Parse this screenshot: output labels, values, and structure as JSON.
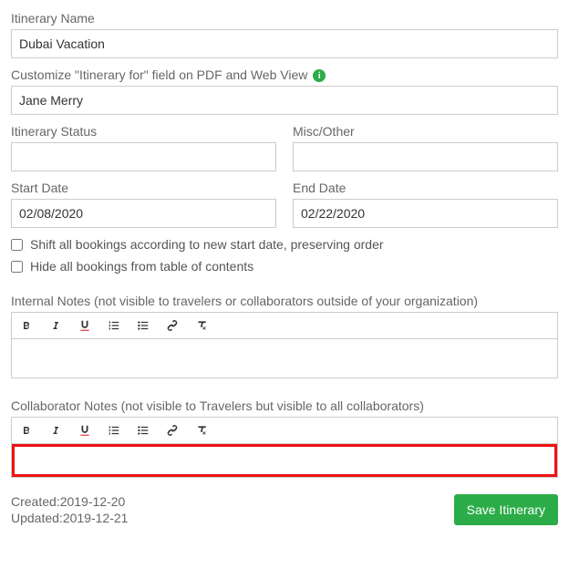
{
  "itinerary_name_label": "Itinerary Name",
  "itinerary_name_value": "Dubai Vacation",
  "customize_label": "Customize \"Itinerary for\" field on PDF and Web View",
  "customize_value": "Jane Merry",
  "status_label": "Itinerary Status",
  "status_value": "",
  "misc_label": "Misc/Other",
  "misc_value": "",
  "start_date_label": "Start Date",
  "start_date_value": "02/08/2020",
  "end_date_label": "End Date",
  "end_date_value": "02/22/2020",
  "shift_label": "Shift all bookings according to new start date, preserving order",
  "hide_label": "Hide all bookings from table of contents",
  "internal_notes_label": "Internal Notes (not visible to travelers or collaborators outside of your organization)",
  "collab_notes_label": "Collaborator Notes (not visible to Travelers but visible to all collaborators)",
  "created_label": "Created:",
  "created_value": "2019-12-20",
  "updated_label": "Updated:",
  "updated_value": "2019-12-21",
  "save_label": "Save Itinerary",
  "info_char": "i"
}
